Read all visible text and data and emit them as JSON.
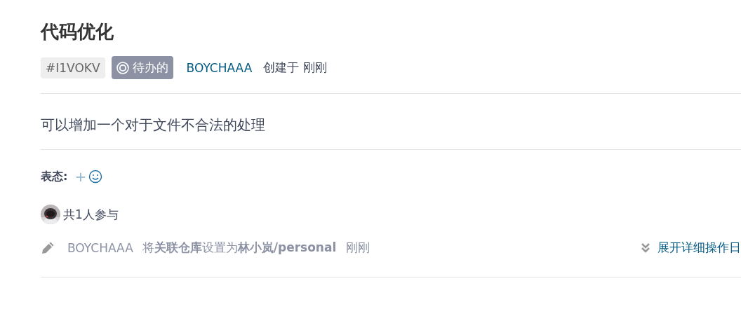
{
  "issue": {
    "title": "代码优化",
    "number": "#I1VOKV",
    "status": {
      "label": "待办的",
      "kind": "todo"
    },
    "author": "BOYCHAAA",
    "created": "创建于 刚刚"
  },
  "description": "可以增加一个对于文件不合法的处理",
  "reactions": {
    "label": "表态:",
    "add": "+"
  },
  "participants": {
    "text": "共1人参与"
  },
  "activity": {
    "user": "BOYCHAAA",
    "action": "将**关联仓库**设置为**林小岚/personal**",
    "time": "刚刚",
    "expand": "展开详细操作日"
  }
}
